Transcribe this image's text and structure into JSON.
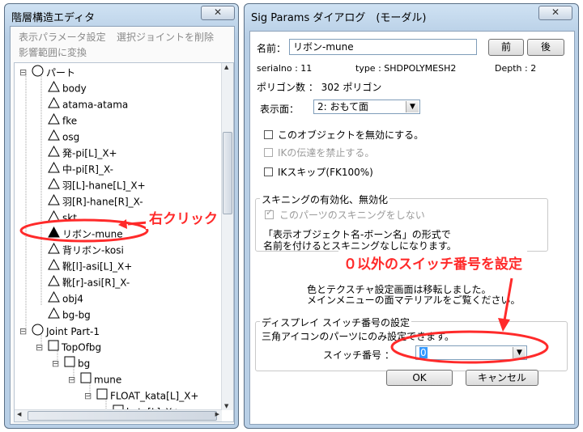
{
  "left_window": {
    "title": "階層構造エディタ",
    "close": "✕",
    "menu": [
      "表示パラメータ設定",
      "選択ジョイントを削除",
      "影響範囲に変換"
    ],
    "tree": [
      {
        "label": "パート",
        "expander": "⊟",
        "icon": "circle"
      },
      {
        "label": "body",
        "icon": "triangle"
      },
      {
        "label": "atama-atama",
        "icon": "triangle"
      },
      {
        "label": "fke",
        "icon": "triangle"
      },
      {
        "label": "osg",
        "icon": "triangle"
      },
      {
        "label": "発-pi[L]_X+",
        "icon": "triangle"
      },
      {
        "label": "中-pi[R]_X-",
        "icon": "triangle"
      },
      {
        "label": "羽[L]-hane[L]_X+",
        "icon": "triangle"
      },
      {
        "label": "羽[R]-hane[R]_X-",
        "icon": "triangle"
      },
      {
        "label": "skt",
        "icon": "triangle"
      },
      {
        "label": "リボン-mune",
        "icon": "triangle-filled"
      },
      {
        "label": "背リボン-kosi",
        "icon": "triangle"
      },
      {
        "label": "靴[l]-asi[L]_X+",
        "icon": "triangle"
      },
      {
        "label": "靴[r]-asi[R]_X-",
        "icon": "triangle"
      },
      {
        "label": "obj4",
        "icon": "triangle"
      },
      {
        "label": "bg-bg",
        "icon": "triangle"
      },
      {
        "label": "Joint Part-1",
        "expander": "⊟",
        "icon": "circle"
      },
      {
        "label": "TopOfbg",
        "expander": "⊟",
        "icon": "square"
      },
      {
        "label": "bg",
        "expander": "⊟",
        "icon": "square"
      },
      {
        "label": "mune",
        "expander": "⊟",
        "icon": "square"
      },
      {
        "label": "FLOAT_kata[L]_X+",
        "expander": "⊟",
        "icon": "square"
      },
      {
        "label": "kata[L]_X+",
        "expander": "⊟",
        "icon": "square"
      }
    ],
    "annotation_right_click": "右クリック"
  },
  "dialog": {
    "title": "Sig Params ダイアログ　(モーダル)",
    "close": "✕",
    "name_label": "名前：",
    "name_value": "リボン-mune",
    "prev_button": "前",
    "next_button": "後",
    "serialno": "serialno : 11",
    "type": "type : SHDPOLYMESH2",
    "depth": "Depth : 2",
    "polygon_count": "ポリゴン数 ： 302 ポリゴン",
    "face_label": "表示面：",
    "face_value": "2: おもて面",
    "check_disable": "このオブジェクトを無効にする。",
    "check_ik_block": "IKの伝達を禁止する。",
    "check_ik_skip": "IKスキップ(FK100%)",
    "skin_group_title": "スキニングの有効化、無効化",
    "skin_check": "このパーツのスキニングをしない",
    "skin_note_1": "「表示オブジェクト名-ボーン名」の形式で",
    "skin_note_2": "名前を付けるとスキニングなしになります。",
    "color_note_1": "色とテクスチャ設定画面は移転しました。",
    "color_note_2": "メインメニューの面マテリアルをご覧ください。",
    "switch_group_title": "ディスプレイ スイッチ番号の設定",
    "switch_note": "三角アイコンのパーツにのみ設定できます。",
    "switch_label": "スイッチ番号 ：",
    "switch_value": "0",
    "ok_button": "OK",
    "cancel_button": "キャンセル",
    "annotation_switch": "０以外のスイッチ番号を設定"
  },
  "colors": {
    "annotation": "#ff2a2a",
    "selection": "#3399ff"
  }
}
